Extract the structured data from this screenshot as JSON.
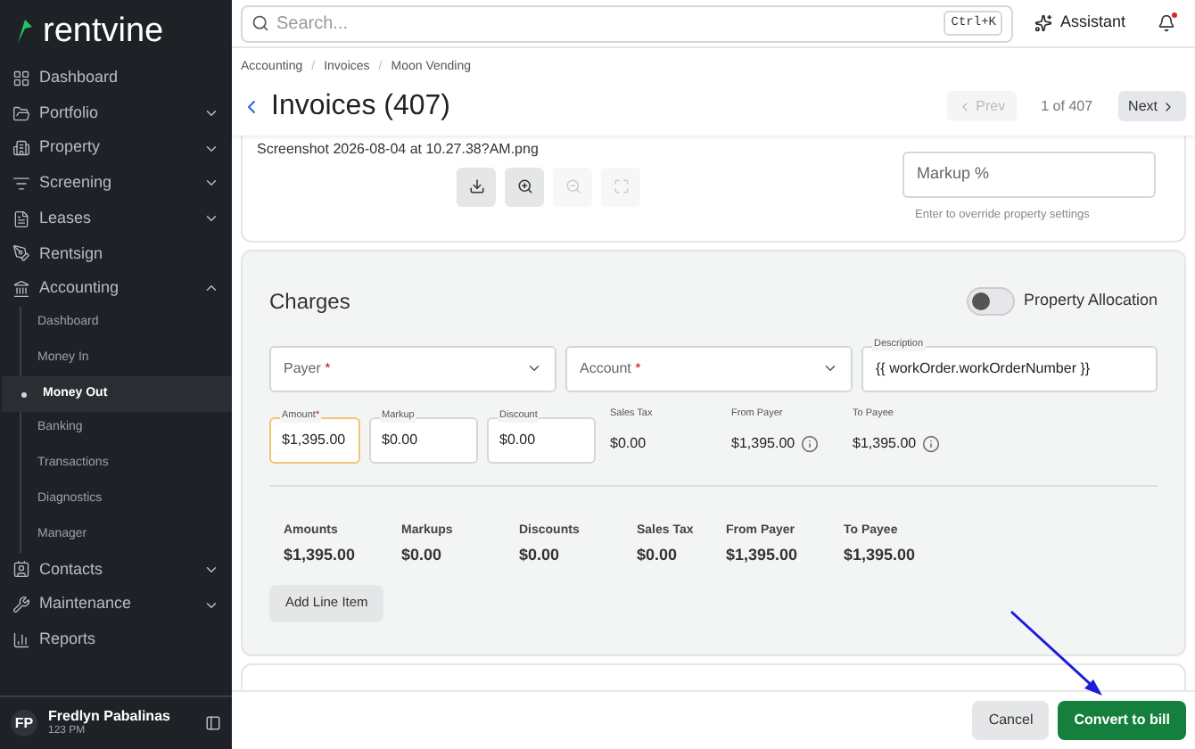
{
  "sidebar": {
    "logo": "rentvine",
    "items": [
      {
        "label": "Dashboard"
      },
      {
        "label": "Portfolio",
        "expanded": false
      },
      {
        "label": "Property",
        "expanded": false
      },
      {
        "label": "Screening",
        "expanded": false
      },
      {
        "label": "Leases",
        "expanded": false
      },
      {
        "label": "Rentsign"
      },
      {
        "label": "Accounting",
        "expanded": true,
        "children": [
          {
            "label": "Dashboard",
            "selected": false
          },
          {
            "label": "Money In",
            "selected": false
          },
          {
            "label": "Money Out",
            "selected": true
          },
          {
            "label": "Banking",
            "selected": false
          },
          {
            "label": "Transactions",
            "selected": false
          },
          {
            "label": "Diagnostics",
            "selected": false
          },
          {
            "label": "Manager",
            "selected": false
          }
        ]
      },
      {
        "label": "Contacts",
        "expanded": false
      },
      {
        "label": "Maintenance",
        "expanded": false
      },
      {
        "label": "Reports"
      }
    ],
    "user": {
      "initials": "FP",
      "name": "Fredlyn Pabalinas",
      "subtitle": "123 PM"
    }
  },
  "topbar": {
    "search": {
      "placeholder": "Search..."
    },
    "shortcut": "Ctrl+K",
    "assistant": "Assistant",
    "notification_dot": true
  },
  "header": {
    "breadcrumbs": [
      "Accounting",
      "Invoices",
      "Moon Vending"
    ],
    "breadcrumb_separator": "/",
    "title": "Invoices (407)",
    "prev": {
      "label": "Prev",
      "disabled": true
    },
    "pager": "1 of 407",
    "next": {
      "label": "Next",
      "disabled": false
    }
  },
  "attachment": {
    "filename": "Screenshot 2026-08-04 at 10.27.38?AM.png",
    "tools": [
      {
        "kind": "download",
        "disabled": false
      },
      {
        "kind": "zoom-in",
        "disabled": false
      },
      {
        "kind": "zoom-out",
        "disabled": true
      },
      {
        "kind": "fullscreen",
        "disabled": true
      }
    ],
    "markup": {
      "placeholder": "Markup %",
      "hint": "Enter to override property settings"
    }
  },
  "charges": {
    "title": "Charges",
    "property_allocation": {
      "label": "Property Allocation",
      "on": false
    },
    "payer": {
      "placeholder": "Payer",
      "required_mark": "*"
    },
    "account": {
      "placeholder": "Account",
      "required_mark": "*"
    },
    "description": {
      "label": "Description",
      "value": "{{ workOrder.workOrderNumber }}"
    },
    "line": [
      {
        "kind": "input",
        "label": "Amount",
        "required_mark": "*",
        "value": "$1,395.00",
        "focused": true
      },
      {
        "kind": "input",
        "label": "Markup",
        "value": "$0.00",
        "focused": false
      },
      {
        "kind": "input",
        "label": "Discount",
        "value": "$0.00",
        "focused": false
      },
      {
        "kind": "readout",
        "label": "Sales Tax",
        "value": "$0.00",
        "info": false
      },
      {
        "kind": "readout",
        "label": "From Payer",
        "value": "$1,395.00",
        "info": true
      },
      {
        "kind": "readout",
        "label": "To Payee",
        "value": "$1,395.00",
        "info": true
      }
    ],
    "totals": [
      {
        "label": "Amounts",
        "value": "$1,395.00"
      },
      {
        "label": "Markups",
        "value": "$0.00"
      },
      {
        "label": "Discounts",
        "value": "$0.00"
      },
      {
        "label": "Sales Tax",
        "value": "$0.00"
      },
      {
        "label": "From Payer",
        "value": "$1,395.00"
      },
      {
        "label": "To Payee",
        "value": "$1,395.00"
      }
    ],
    "add_button": "Add Line Item"
  },
  "footer": {
    "cancel": "Cancel",
    "submit": "Convert to bill"
  }
}
